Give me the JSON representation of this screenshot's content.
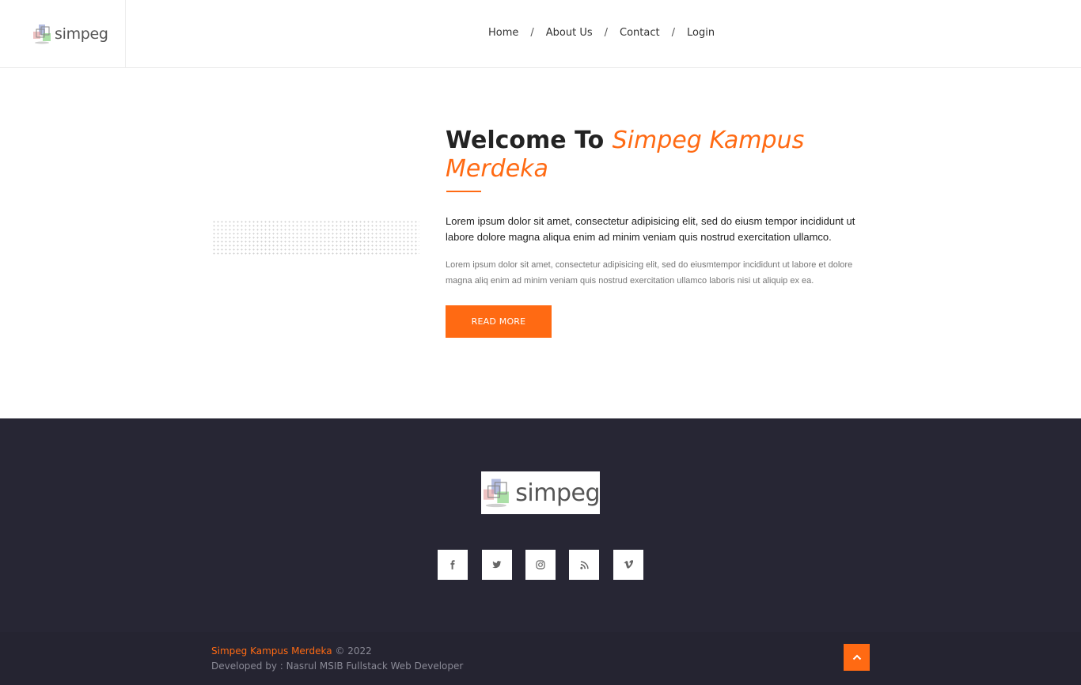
{
  "header": {
    "logo_text": "simpeg",
    "nav": [
      "Home",
      "About Us",
      "Contact",
      "Login"
    ],
    "separator": "/"
  },
  "welcome": {
    "heading_prefix": "Welcome To ",
    "heading_accent": "Simpeg Kampus Merdeka",
    "paragraph_1": "Lorem ipsum dolor sit amet, consectetur adipisicing elit, sed do eiusm tempor incididunt ut labore dolore magna aliqua enim ad minim veniam quis nostrud exercitation ullamco.",
    "paragraph_2": "Lorem ipsum dolor sit amet, consectetur adipisicing elit, sed do eiusmtempor incididunt ut labore et dolore magna aliq enim ad minim veniam quis nostrud exercitation ullamco laboris nisi ut aliquip ex ea.",
    "button_label": "READ MORE"
  },
  "footer": {
    "logo_text": "simpeg",
    "social_icons": [
      "facebook-icon",
      "twitter-icon",
      "instagram-icon",
      "rss-icon",
      "vimeo-icon"
    ],
    "copyright_brand": "Simpeg Kampus Merdeka",
    "copyright_year": "© 2022",
    "developer": "Developed by : Nasrul MSIB Fullstack Web Developer"
  },
  "colors": {
    "accent": "#ff6a13",
    "footer_bg": "#272634",
    "heading": "#232323"
  }
}
